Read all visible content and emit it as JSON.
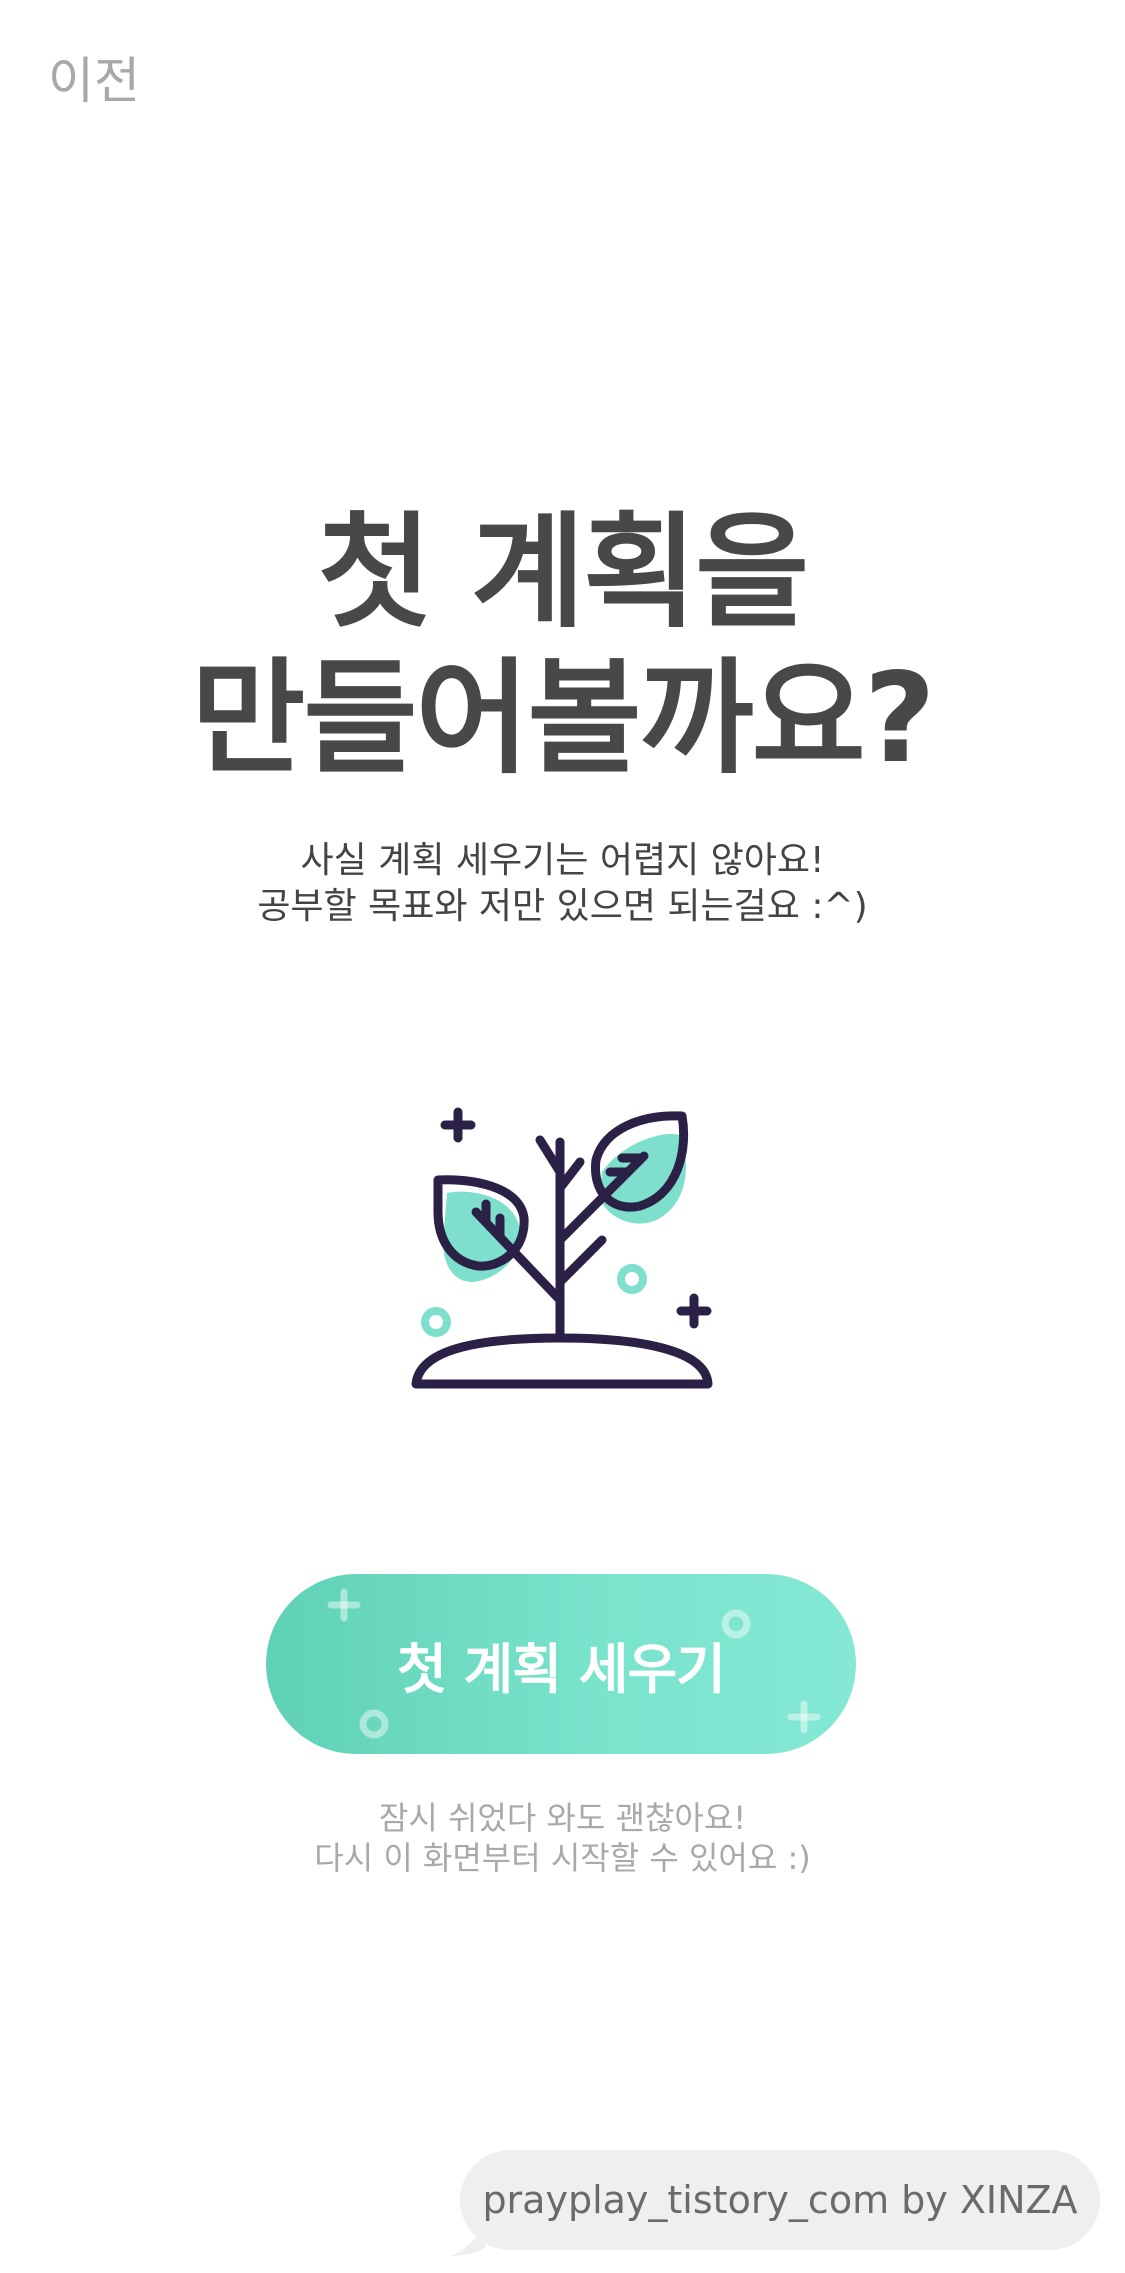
{
  "nav": {
    "back_label": "이전"
  },
  "hero": {
    "title_line1": "첫 계획을",
    "title_line2": "만들어볼까요?",
    "subtitle_line1": "사실 계획 세우기는 어렵지 않아요!",
    "subtitle_line2": "공부할 목표와 저만 있으면 되는걸요 :^)"
  },
  "illustration": {
    "icon": "sprout-plant-icon"
  },
  "cta": {
    "label": "첫 계획 세우기"
  },
  "footnote": {
    "line1": "잠시 쉬었다 와도 괜찮아요!",
    "line2": "다시 이 화면부터 시작할 수 있어요 :)"
  },
  "watermark": {
    "text": "prayplay_tistory_com by XINZA"
  },
  "colors": {
    "title": "#484848",
    "accent": "#79e3cc",
    "accent_dark": "#5fd1b5",
    "illustration_stroke": "#2b2147",
    "muted_text": "#a9a9a9"
  }
}
